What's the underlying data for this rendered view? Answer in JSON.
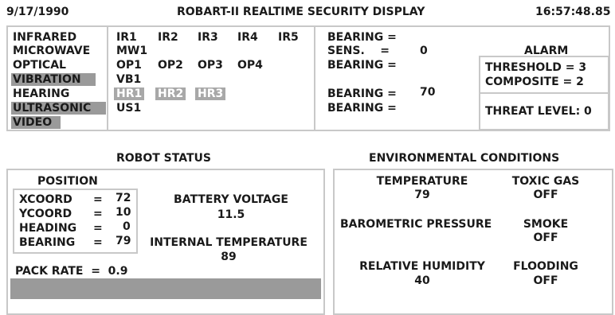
{
  "header": {
    "date": "9/17/1990",
    "title": "ROBART-II REALTIME SECURITY DISPLAY",
    "time": "16:57:48.85"
  },
  "sensors": {
    "categories": [
      "INFRARED",
      "MICROWAVE",
      "OPTICAL",
      "VIBRATION",
      "HEARING",
      "ULTRASONIC",
      "VIDEO"
    ],
    "highlighted": [
      "VIBRATION",
      "ULTRASONIC",
      "VIDEO"
    ],
    "rows": [
      [
        "IR1",
        "IR2",
        "IR3",
        "IR4",
        "IR5"
      ],
      [
        "MW1"
      ],
      [
        "OP1",
        "OP2",
        "OP3",
        "OP4"
      ],
      [
        "VB1"
      ],
      [
        "HR1",
        "HR2",
        "HR3"
      ],
      [
        "US1"
      ]
    ],
    "bearing_label": "BEARING",
    "sens_label": "SENS.",
    "sens_value": "0",
    "bearing_value": "70"
  },
  "alarm": {
    "title": "ALARM",
    "threshold": "THRESHOLD = 3",
    "composite": "COMPOSITE = 2",
    "threat": "THREAT LEVEL: 0"
  },
  "robot": {
    "title": "ROBOT STATUS",
    "position_title": "POSITION",
    "xcoord_label": "XCOORD",
    "xcoord_value": "72",
    "ycoord_label": "YCOORD",
    "ycoord_value": "10",
    "heading_label": "HEADING",
    "heading_value": "0",
    "bearing_label": "BEARING",
    "bearing_value": "79",
    "battery_label": "BATTERY VOLTAGE",
    "battery_value": "11.5",
    "int_temp_label": "INTERNAL TEMPERATURE",
    "int_temp_value": "89",
    "pack_rate": "PACK RATE  =  0.9"
  },
  "env": {
    "title": "ENVIRONMENTAL CONDITIONS",
    "temp_label": "TEMPERATURE",
    "temp_value": "79",
    "toxic_label": "TOXIC GAS",
    "toxic_value": "OFF",
    "baro_label": "BAROMETRIC PRESSURE",
    "smoke_label": "SMOKE",
    "smoke_value": "OFF",
    "humidity_label": "RELATIVE HUMIDITY",
    "humidity_value": "40",
    "flood_label": "FLOODING",
    "flood_value": "OFF"
  }
}
